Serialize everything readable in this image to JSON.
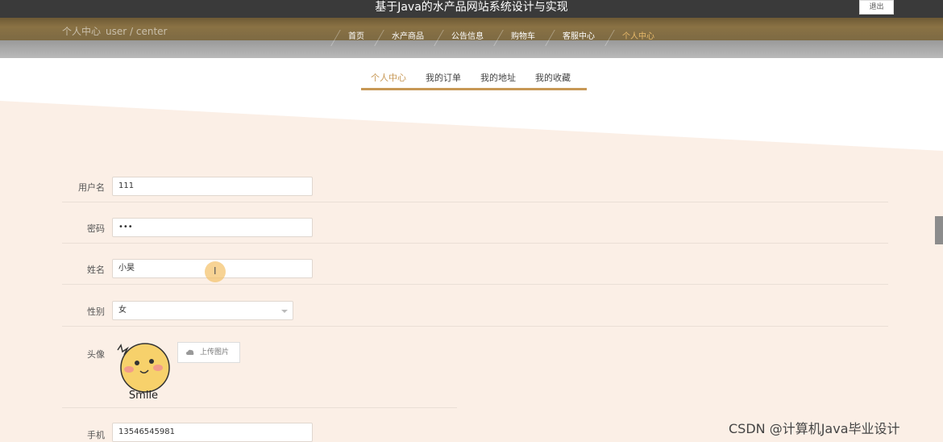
{
  "header": {
    "site_title": "基于Java的水产品网站系统设计与实现",
    "logout_label": "退出"
  },
  "breadcrumb": {
    "title": "个人中心",
    "subtitle": "user / center"
  },
  "nav": {
    "items": [
      {
        "label": "首页"
      },
      {
        "label": "水产商品"
      },
      {
        "label": "公告信息"
      },
      {
        "label": "购物车"
      },
      {
        "label": "客服中心"
      },
      {
        "label": "个人中心",
        "active": true
      }
    ]
  },
  "tabs": [
    {
      "label": "个人中心",
      "active": true
    },
    {
      "label": "我的订单"
    },
    {
      "label": "我的地址"
    },
    {
      "label": "我的收藏"
    }
  ],
  "form": {
    "username": {
      "label": "用户名",
      "value": "111"
    },
    "password": {
      "label": "密码",
      "value": "•••"
    },
    "name": {
      "label": "姓名",
      "value": "小昊"
    },
    "gender": {
      "label": "性别",
      "value": "女"
    },
    "avatar": {
      "label": "头像",
      "upload_label": "上传图片",
      "image_text": "Smile"
    },
    "phone": {
      "label": "手机",
      "value": "13546545981"
    }
  },
  "watermark": "CSDN @计算机Java毕业设计",
  "colors": {
    "accent": "#c79855",
    "content_bg": "#fbefe6",
    "nav_bg": "#7d6a43",
    "topbar_bg": "#3a3a3a"
  }
}
